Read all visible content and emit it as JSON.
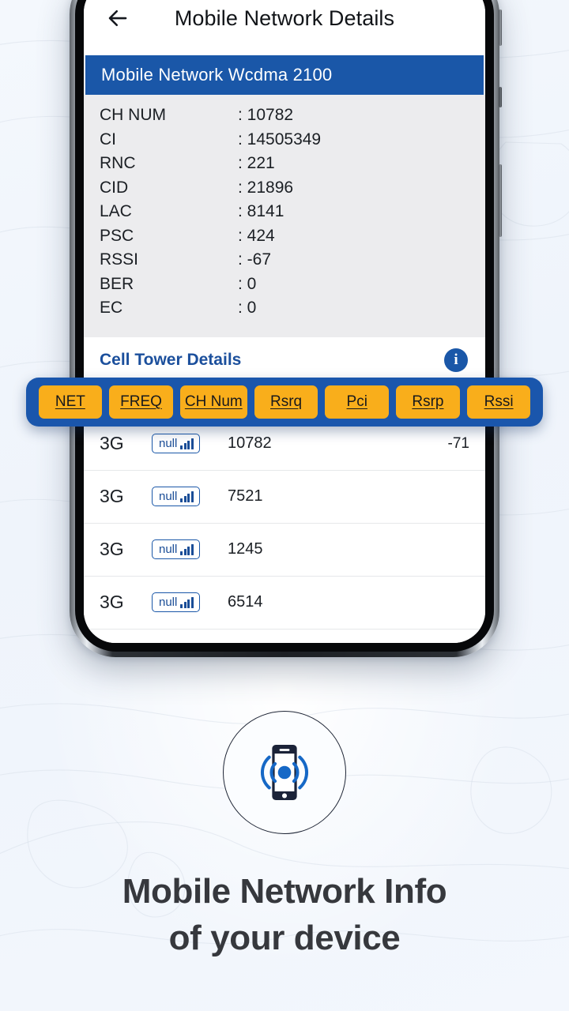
{
  "app": {
    "title": "Mobile Network Details",
    "back_icon": "arrow-left-icon"
  },
  "network_banner": {
    "label": "Mobile Network Wcdma 2100"
  },
  "details": {
    "rows": [
      {
        "key": "CH NUM",
        "value": ": 10782"
      },
      {
        "key": "CI",
        "value": ": 14505349"
      },
      {
        "key": "RNC",
        "value": ": 221"
      },
      {
        "key": "CID",
        "value": ": 21896"
      },
      {
        "key": "LAC",
        "value": ": 8141"
      },
      {
        "key": "PSC",
        "value": ": 424"
      },
      {
        "key": "RSSI",
        "value": ": -67"
      },
      {
        "key": "BER",
        "value": ": 0"
      },
      {
        "key": "EC",
        "value": ": 0"
      }
    ]
  },
  "cell_tower": {
    "title": "Cell Tower Details",
    "info_icon": "info-icon",
    "info_glyph": "i",
    "columns": [
      {
        "label": "NET"
      },
      {
        "label": "FREQ"
      },
      {
        "label": "CH Num"
      },
      {
        "label": "Rsrq"
      },
      {
        "label": "Pci"
      },
      {
        "label": "Rsrp"
      },
      {
        "label": "Rssi"
      }
    ],
    "rows": [
      {
        "net": "3G",
        "freq_badge": "null",
        "freq_icon": "signal-bars-icon",
        "ch_num": "10782",
        "rsrq": "",
        "pci": "",
        "rsrp": "",
        "rssi": "-71"
      },
      {
        "net": "3G",
        "freq_badge": "null",
        "freq_icon": "signal-bars-icon",
        "ch_num": "7521",
        "rsrq": "",
        "pci": "",
        "rsrp": "",
        "rssi": ""
      },
      {
        "net": "3G",
        "freq_badge": "null",
        "freq_icon": "signal-bars-icon",
        "ch_num": "1245",
        "rsrq": "",
        "pci": "",
        "rsrp": "",
        "rssi": ""
      },
      {
        "net": "3G",
        "freq_badge": "null",
        "freq_icon": "signal-bars-icon",
        "ch_num": "6514",
        "rsrq": "",
        "pci": "",
        "rsrp": "",
        "rssi": ""
      }
    ]
  },
  "promo": {
    "icon": "phone-signal-icon",
    "line1": "Mobile Network Info",
    "line2": "of your device"
  },
  "colors": {
    "brand_blue": "#1a57a8",
    "highlight_blue": "#1a56ac",
    "accent_amber": "#f9ae1b",
    "page_background": "#f2f6fc",
    "detail_background": "#ececee",
    "text_dark": "#36383d"
  }
}
